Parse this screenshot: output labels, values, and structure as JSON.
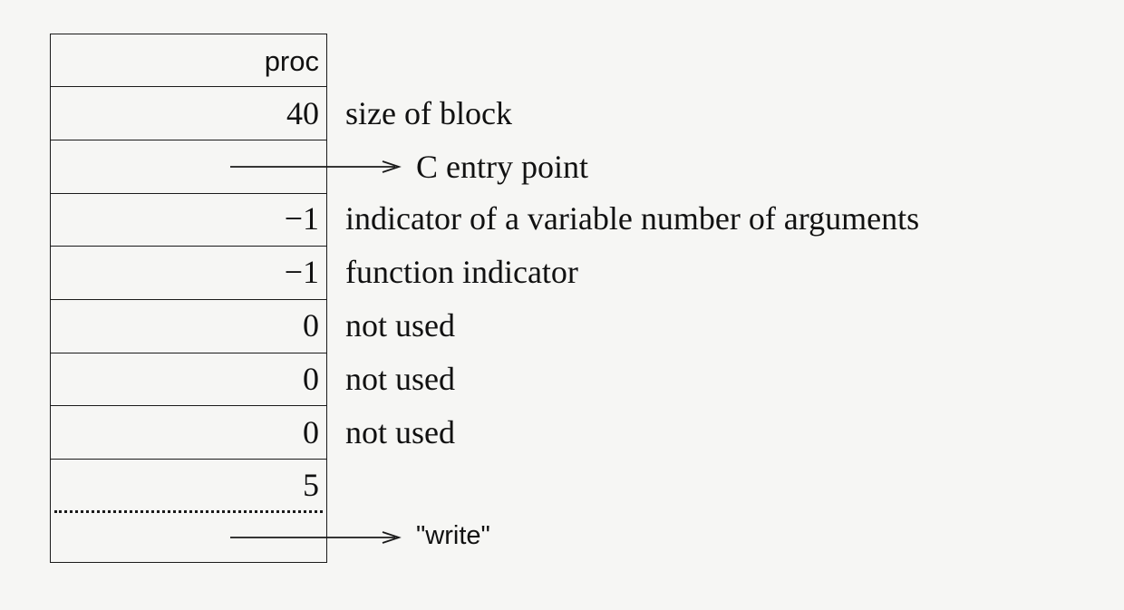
{
  "rows": [
    {
      "value": "proc",
      "description": ""
    },
    {
      "value": "40",
      "description": "size of block"
    },
    {
      "value": "",
      "description": ""
    },
    {
      "value": "−1",
      "description": "indicator of a variable number of arguments"
    },
    {
      "value": "−1",
      "description": "function indicator"
    },
    {
      "value": "0",
      "description": "not used"
    },
    {
      "value": "0",
      "description": "not used"
    },
    {
      "value": "0",
      "description": "not used"
    },
    {
      "value": "5",
      "description": ""
    }
  ],
  "arrows": {
    "c_entry_point": "C entry point",
    "write_string": "\"write\""
  }
}
